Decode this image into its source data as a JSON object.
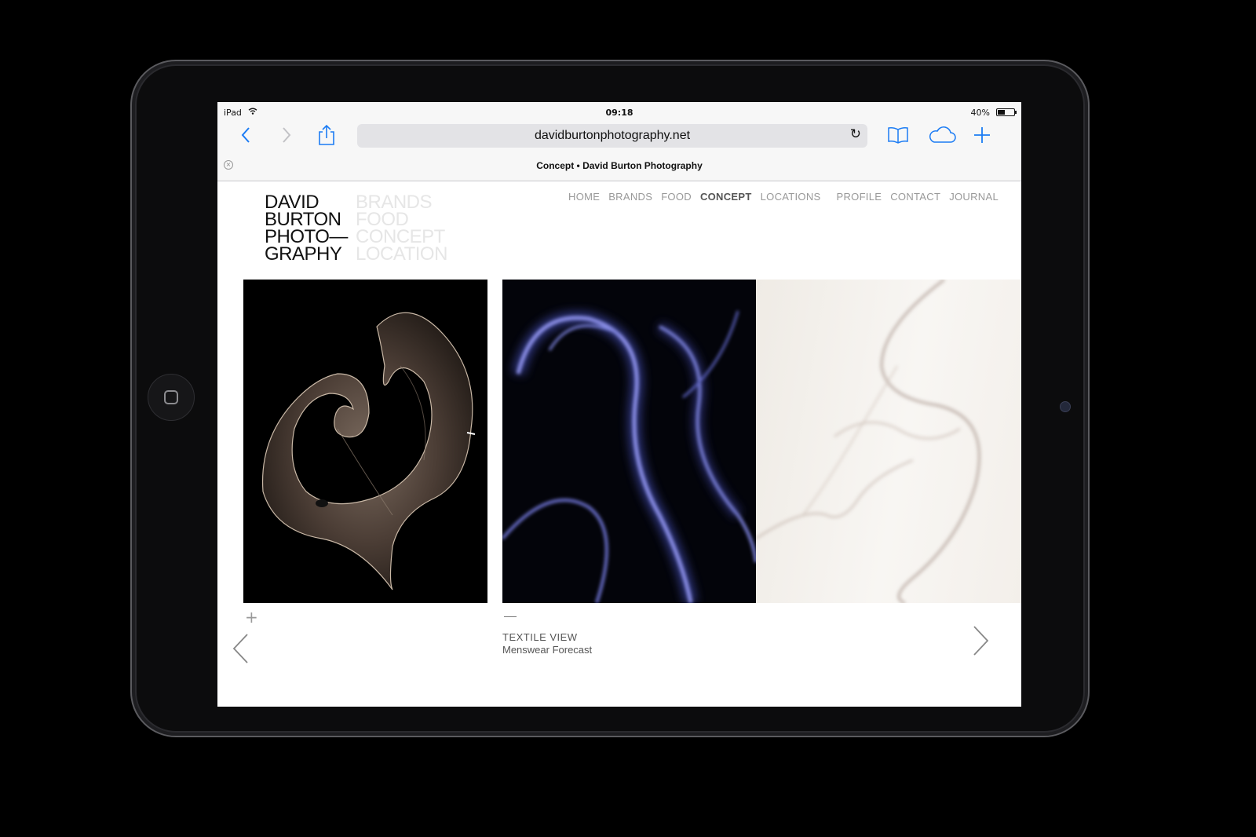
{
  "status_bar": {
    "carrier": "iPad",
    "time": "09:18",
    "battery": "40%"
  },
  "browser": {
    "url": "davidburtonphotography.net",
    "tab_title": "Concept • David Burton Photography"
  },
  "site": {
    "logo_lines": [
      "DAVID",
      "BURTON",
      "PHOTO—",
      "GRAPHY"
    ],
    "logo_sub_lines": [
      "BRANDS",
      "FOOD",
      "CONCEPT",
      "LOCATION"
    ],
    "nav": [
      "HOME",
      "BRANDS",
      "FOOD",
      "CONCEPT",
      "LOCATIONS",
      "PROFILE",
      "CONTACT",
      "JOURNAL"
    ],
    "nav_active": "CONCEPT",
    "caption_title": "TEXTILE VIEW",
    "caption_sub": "Menswear Forecast"
  },
  "colors": {
    "accent": "#1c7cf4",
    "nav": "#999999",
    "nav_active": "#555555"
  }
}
